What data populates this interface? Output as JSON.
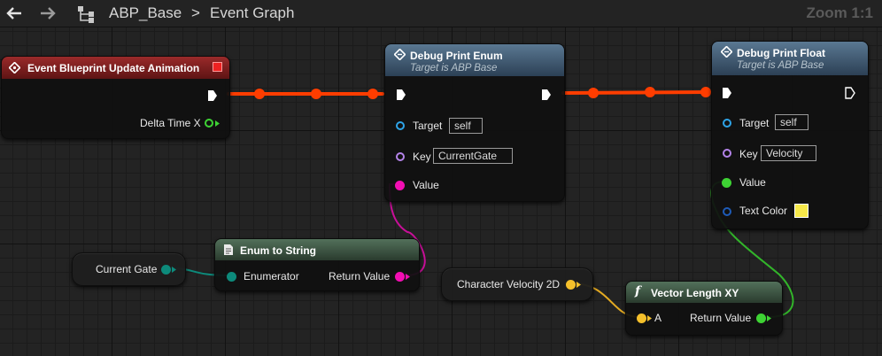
{
  "toolbar": {
    "back_icon": "arrow-left-icon",
    "forward_icon": "arrow-right-icon",
    "graph_icon": "hierarchy-icon",
    "crumb_asset": "ABP_Base",
    "crumb_separator": ">",
    "crumb_graph": "Event Graph",
    "zoom": "Zoom 1:1"
  },
  "nodes": {
    "event_update": {
      "title": "Event Blueprint Update Animation",
      "pin_delta": "Delta Time X"
    },
    "print_enum": {
      "title": "Debug Print Enum",
      "subtitle": "Target is ABP Base",
      "pin_target": "Target",
      "target_value": "self",
      "pin_key": "Key",
      "key_value": "CurrentGate",
      "pin_value": "Value"
    },
    "print_float": {
      "title": "Debug Print Float",
      "subtitle": "Target is ABP Base",
      "pin_target": "Target",
      "target_value": "self",
      "pin_key": "Key",
      "key_value": "Velocity",
      "pin_value": "Value",
      "pin_text_color": "Text Color",
      "text_color_value": "#f6e84a"
    },
    "enum_to_string": {
      "title": "Enum to String",
      "pin_enumerator": "Enumerator",
      "pin_return": "Return Value"
    },
    "vector_length": {
      "title": "Vector Length XY",
      "pin_a": "A",
      "pin_return": "Return Value"
    },
    "current_gate": {
      "label": "Current Gate"
    },
    "char_velocity": {
      "label": "Character Velocity 2D"
    }
  },
  "colors": {
    "exec_wire": "#ff3d00",
    "enum_pin": "#0d8a7b",
    "string_pin": "#f30eb3",
    "float_pin": "#3ed334",
    "vector_pin": "#f5c02b",
    "object_pin": "#2ea4e8",
    "name_pin": "#b484ea"
  }
}
